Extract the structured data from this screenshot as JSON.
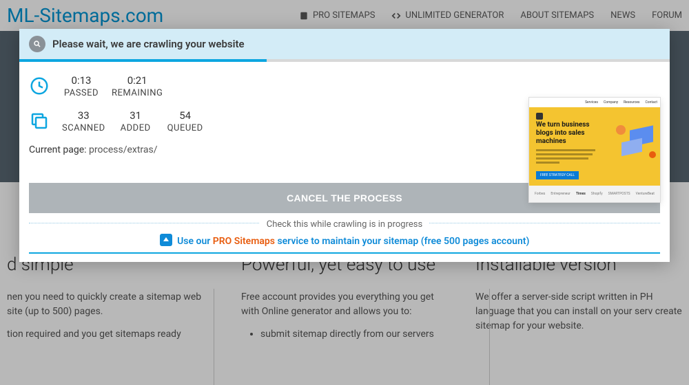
{
  "site": {
    "logo": "ML-Sitemaps.com",
    "nav": {
      "pro": "PRO SITEMAPS",
      "unlimited": "UNLIMITED GENERATOR",
      "about": "ABOUT SITEMAPS",
      "news": "NEWS",
      "forum": "FORUM"
    }
  },
  "background_cards": {
    "col1": {
      "title": "d simple",
      "p1": "nen you need to quickly create a sitemap web site (up to 500) pages.",
      "p2": "tion required and you get sitemaps ready"
    },
    "col2": {
      "title": "Powerful, yet easy to use",
      "p1": "Free account provides you everything you get with Online generator and allows you to:",
      "li1": "submit sitemap directly from our servers"
    },
    "col3": {
      "title": "Installable version",
      "p1": "We offer a server-side script written in PH language that you can install on your serv create sitemap for your website."
    }
  },
  "modal": {
    "title": "Please wait, we are crawling your website",
    "progress_percent": 38,
    "time": {
      "passed_value": "0:13",
      "passed_label": "PASSED",
      "remaining_value": "0:21",
      "remaining_label": "REMAINING"
    },
    "counts": {
      "scanned_value": "33",
      "scanned_label": "SCANNED",
      "added_value": "31",
      "added_label": "ADDED",
      "queued_value": "54",
      "queued_label": "QUEUED"
    },
    "current_page_label": "Current page:",
    "current_page_path": "process/extras/",
    "cancel_label": "CANCEL THE PROCESS",
    "divider_text": "Check this while crawling is in progress",
    "promo_prefix": "Use our ",
    "promo_brand": "PRO Sitemaps",
    "promo_suffix": " service to maintain your sitemap (free 500 pages account)"
  },
  "preview": {
    "nav": [
      "Services",
      "Company",
      "Resources",
      "Contact"
    ],
    "title": "We turn business blogs into sales machines",
    "cta": "FREE STRATEGY CALL",
    "footer_logos": [
      "Forbes",
      "Entrepreneur",
      "Times",
      "Shopify",
      "SMARTPOSTS",
      "VentureBeat"
    ]
  }
}
